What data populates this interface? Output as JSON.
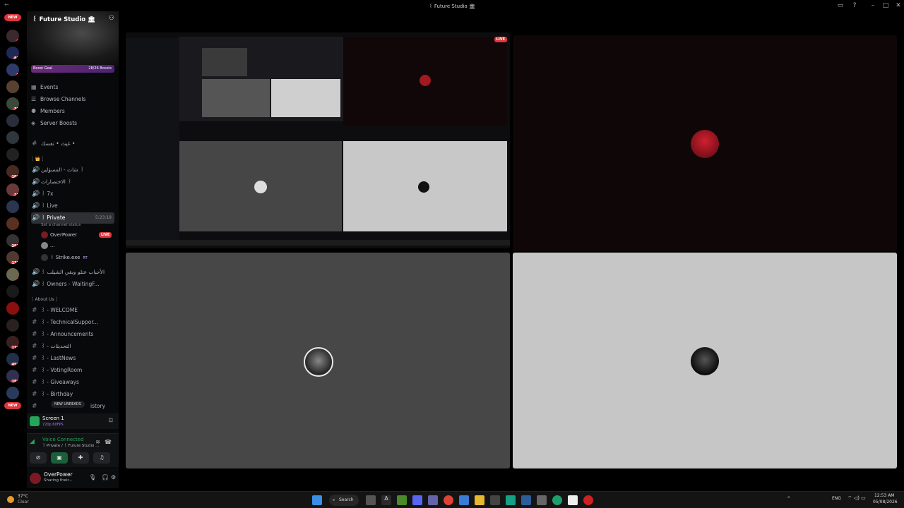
{
  "window": {
    "title": "꒰ Future Studio 🏛"
  },
  "rail": {
    "new_top": "NEW",
    "new_bottom": "NEW",
    "badges": [
      "1",
      "81",
      "2",
      "37",
      "106",
      "23",
      "269",
      "132",
      "4",
      "170",
      "453",
      "186"
    ]
  },
  "server": {
    "name": "꒰ Future Studio 🏛",
    "boost_label": "Boost Goal",
    "boost_value": "28/26 Boosts"
  },
  "nav": [
    {
      "label": "Events"
    },
    {
      "label": "Browse Channels"
    },
    {
      "label": "Members"
    },
    {
      "label": "Server Boosts"
    }
  ],
  "channels_top": {
    "label": "غيث • تفسك •"
  },
  "category_1": {
    "label": "┊ 👑 ┊"
  },
  "channels_1": [
    {
      "label": "شات - المسؤلين ꒱"
    },
    {
      "label": "الاختصارات ꒱"
    },
    {
      "label": "꒱ 7x"
    },
    {
      "label": "꒱ Live"
    }
  ],
  "active_channel": {
    "label": "꒱ Private",
    "time": "5:23:19",
    "status": "Set a channel status"
  },
  "voice_users": [
    {
      "name": "OverPower",
      "badge": "LIVE"
    },
    {
      "name": "..."
    },
    {
      "name": "꒰ Strike.exe",
      "badge": "RT"
    }
  ],
  "channels_2": [
    {
      "label": "꒱ الأحباب عتلو وبقي الشيلب"
    },
    {
      "label": "꒱ Owners - WaitingF..."
    }
  ],
  "category_2": {
    "label": "┊ About Us ┊"
  },
  "channels_3": [
    {
      "label": "꒱ - WELCOME"
    },
    {
      "label": "꒱ - TechnicalSuppor..."
    },
    {
      "label": "꒱ - Announcements"
    },
    {
      "label": "꒱ - التحديثات"
    },
    {
      "label": "꒱ - LastNews"
    },
    {
      "label": "꒱ - VotingRoom"
    },
    {
      "label": "꒱ - Giveaways"
    },
    {
      "label": "꒱ - Birthday"
    },
    {
      "label": "istory"
    }
  ],
  "new_unreads": "NEW UNREADS",
  "screen_panel": {
    "title": "Screen 1",
    "sub": "720p 60FPS"
  },
  "voice_panel": {
    "status": "Voice Connected",
    "location": "꒱ Private / ꒰ Future Studio ..."
  },
  "user_panel": {
    "name": "OverPower",
    "status": "Sharing their..."
  },
  "stage": {
    "live_badge": "LIVE"
  },
  "taskbar": {
    "weather_temp": "37°C",
    "weather_desc": "Clear",
    "search": "Search",
    "lang": "ENG",
    "time": "12:53 AM",
    "date": "05/08/2026"
  },
  "colors": {
    "accent_red": "#da373c",
    "boost_purple": "#6b2a7a",
    "online_green": "#23a55a"
  }
}
